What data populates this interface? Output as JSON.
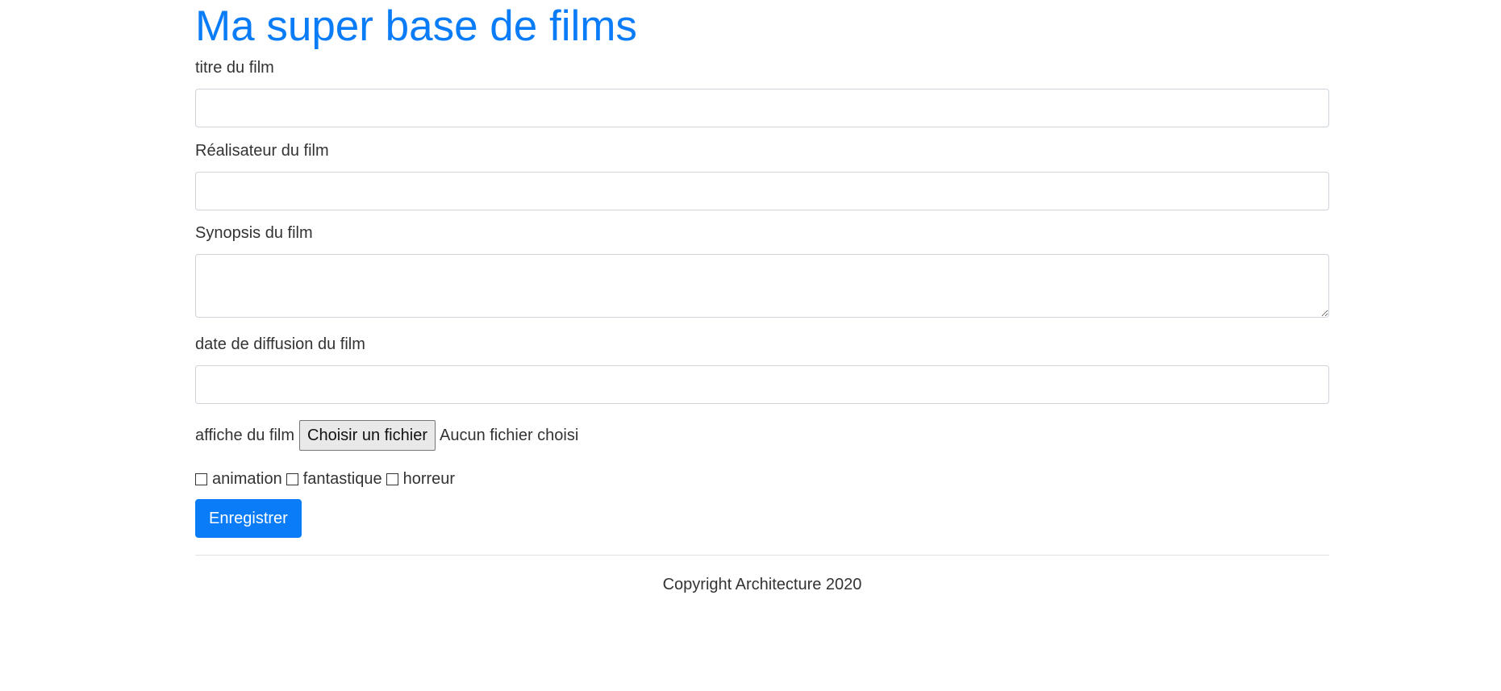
{
  "page": {
    "title": "Ma super base de films"
  },
  "form": {
    "titre": {
      "label": "titre du film",
      "value": "",
      "placeholder": ""
    },
    "realisateur": {
      "label": "Réalisateur du film",
      "value": "",
      "placeholder": ""
    },
    "synopsis": {
      "label": "Synopsis du film",
      "value": "",
      "placeholder": ""
    },
    "date": {
      "label": "date de diffusion du film",
      "value": "",
      "placeholder": ""
    },
    "affiche": {
      "label": "affiche du film",
      "button_label": "Choisir un fichier",
      "status": "Aucun fichier choisi"
    },
    "genres": [
      {
        "label": "animation",
        "checked": false
      },
      {
        "label": "fantastique",
        "checked": false
      },
      {
        "label": "horreur",
        "checked": false
      }
    ],
    "submit_label": "Enregistrer"
  },
  "footer": {
    "text": "Copyright Architecture 2020"
  },
  "colors": {
    "accent": "#0a7cf7",
    "text": "#333333",
    "border": "#ced4da"
  }
}
